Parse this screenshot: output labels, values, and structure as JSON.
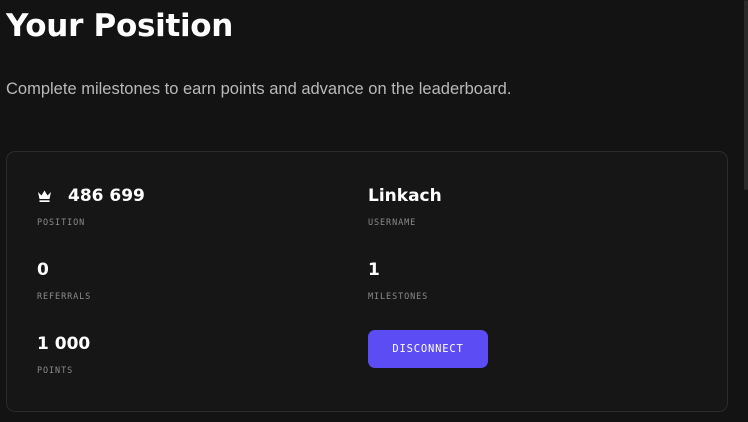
{
  "header": {
    "title": "Your Position",
    "subtitle": "Complete milestones to earn points and advance on the leaderboard."
  },
  "stats": {
    "position": {
      "icon": "crown-icon",
      "value": "486 699",
      "label": "POSITION"
    },
    "username": {
      "value": "Linkach",
      "label": "USERNAME"
    },
    "referrals": {
      "value": "0",
      "label": "REFERRALS"
    },
    "milestones": {
      "value": "1",
      "label": "MILESTONES"
    },
    "points": {
      "value": "1 000",
      "label": "POINTS"
    }
  },
  "actions": {
    "disconnect_label": "DISCONNECT"
  },
  "colors": {
    "background": "#131313",
    "card_background": "#161616",
    "card_border": "#2b2b2b",
    "accent": "#5b4cf4",
    "text_primary": "#ffffff",
    "text_secondary": "#b9b9b9",
    "label": "#8a8a8a"
  }
}
